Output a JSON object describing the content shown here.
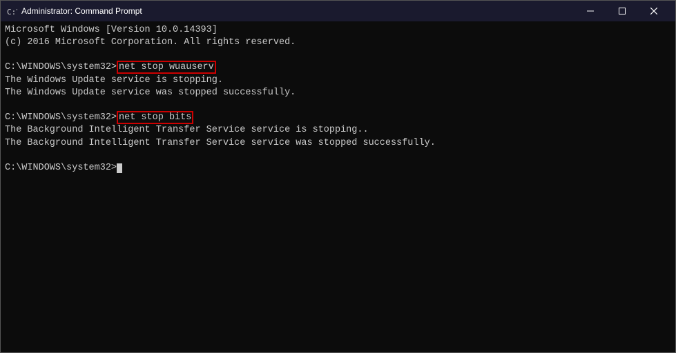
{
  "titleBar": {
    "icon": "cmd-icon",
    "title": "Administrator: Command Prompt",
    "minimizeLabel": "─",
    "maximizeLabel": "□",
    "closeLabel": "✕"
  },
  "console": {
    "lines": [
      {
        "id": "l1",
        "text": "Microsoft Windows [Version 10.0.14393]"
      },
      {
        "id": "l2",
        "text": "(c) 2016 Microsoft Corporation. All rights reserved."
      },
      {
        "id": "l3",
        "text": ""
      },
      {
        "id": "l4",
        "prompt": "C:\\WINDOWS\\system32>",
        "cmd": "net stop wuauserv",
        "highlighted": true
      },
      {
        "id": "l5",
        "text": "The Windows Update service is stopping."
      },
      {
        "id": "l6",
        "text": "The Windows Update service was stopped successfully."
      },
      {
        "id": "l7",
        "text": ""
      },
      {
        "id": "l8",
        "prompt": "C:\\WINDOWS\\system32>",
        "cmd": "net stop bits",
        "highlighted": true
      },
      {
        "id": "l9",
        "text": "The Background Intelligent Transfer Service service is stopping.."
      },
      {
        "id": "l10",
        "text": "The Background Intelligent Transfer Service service was stopped successfully."
      },
      {
        "id": "l11",
        "text": ""
      },
      {
        "id": "l12",
        "prompt": "C:\\WINDOWS\\system32>",
        "cursor": true
      }
    ]
  }
}
